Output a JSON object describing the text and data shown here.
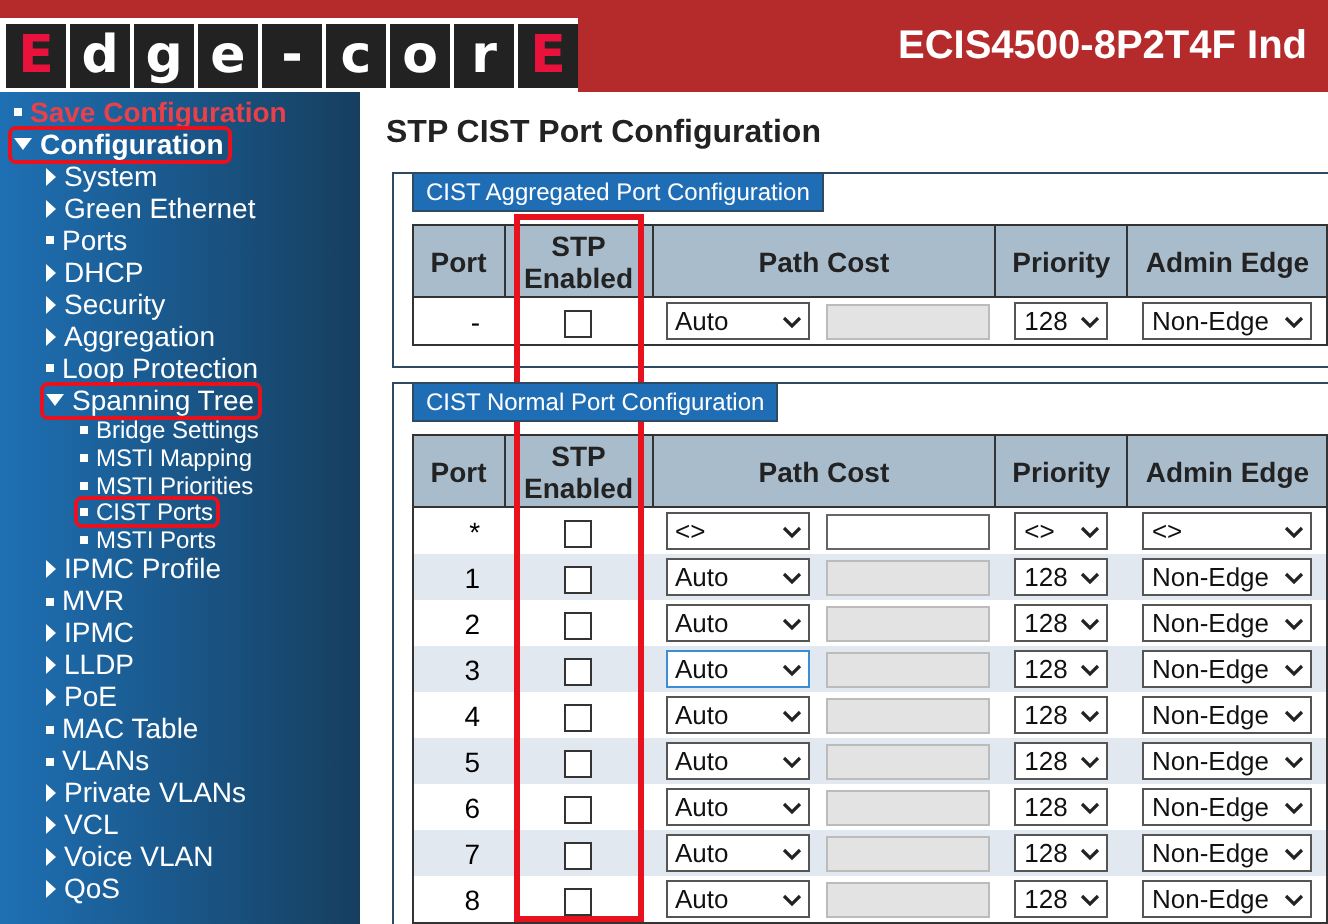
{
  "header": {
    "logo": [
      {
        "char": "E",
        "accent": true
      },
      {
        "char": "d",
        "accent": false
      },
      {
        "char": "g",
        "accent": false
      },
      {
        "char": "e",
        "accent": false
      },
      {
        "char": "-",
        "accent": false
      },
      {
        "char": "c",
        "accent": false
      },
      {
        "char": "o",
        "accent": false
      },
      {
        "char": "r",
        "accent": false
      },
      {
        "char": "E",
        "accent": true
      }
    ],
    "title": "ECIS4500-8P2T4F Ind"
  },
  "sidebar": {
    "items": [
      {
        "label": "Save Configuration",
        "kind": "action",
        "highlighted": false
      },
      {
        "label": "Configuration",
        "kind": "expanded",
        "highlighted": true,
        "children": [
          {
            "label": "System",
            "kind": "collapsed",
            "highlighted": false
          },
          {
            "label": "Green Ethernet",
            "kind": "collapsed",
            "highlighted": false
          },
          {
            "label": "Ports",
            "kind": "leaf",
            "highlighted": false
          },
          {
            "label": "DHCP",
            "kind": "collapsed",
            "highlighted": false
          },
          {
            "label": "Security",
            "kind": "collapsed",
            "highlighted": false
          },
          {
            "label": "Aggregation",
            "kind": "collapsed",
            "highlighted": false
          },
          {
            "label": "Loop Protection",
            "kind": "leaf",
            "highlighted": false
          },
          {
            "label": "Spanning Tree",
            "kind": "expanded",
            "highlighted": true,
            "children": [
              {
                "label": "Bridge Settings",
                "kind": "leaf",
                "highlighted": false
              },
              {
                "label": "MSTI Mapping",
                "kind": "leaf",
                "highlighted": false
              },
              {
                "label": "MSTI Priorities",
                "kind": "leaf",
                "highlighted": false
              },
              {
                "label": "CIST Ports",
                "kind": "leaf",
                "highlighted": true
              },
              {
                "label": "MSTI Ports",
                "kind": "leaf",
                "highlighted": false
              }
            ]
          },
          {
            "label": "IPMC Profile",
            "kind": "collapsed",
            "highlighted": false
          },
          {
            "label": "MVR",
            "kind": "leaf",
            "highlighted": false
          },
          {
            "label": "IPMC",
            "kind": "collapsed",
            "highlighted": false
          },
          {
            "label": "LLDP",
            "kind": "collapsed",
            "highlighted": false
          },
          {
            "label": "PoE",
            "kind": "collapsed",
            "highlighted": false
          },
          {
            "label": "MAC Table",
            "kind": "leaf",
            "highlighted": false
          },
          {
            "label": "VLANs",
            "kind": "leaf",
            "highlighted": false
          },
          {
            "label": "Private VLANs",
            "kind": "collapsed",
            "highlighted": false
          },
          {
            "label": "VCL",
            "kind": "collapsed",
            "highlighted": false
          },
          {
            "label": "Voice VLAN",
            "kind": "collapsed",
            "highlighted": false
          },
          {
            "label": "QoS",
            "kind": "collapsed",
            "highlighted": false
          }
        ]
      }
    ]
  },
  "page_title": "STP CIST Port Configuration",
  "sections": [
    {
      "title": "CIST Aggregated Port Configuration",
      "columns": [
        {
          "label": "Port",
          "highlighted": false
        },
        {
          "label": "STP Enabled",
          "highlighted": true
        },
        {
          "label": "Path Cost",
          "highlighted": false
        },
        {
          "label": "Priority",
          "highlighted": false
        },
        {
          "label": "Admin Edge",
          "highlighted": false
        }
      ],
      "rows": [
        {
          "port": "-",
          "stp_enabled": false,
          "path_cost_mode": "Auto",
          "path_cost_focused": false,
          "path_cost_disabled": true,
          "priority": "128",
          "admin_edge": "Non-Edge"
        }
      ]
    },
    {
      "title": "CIST Normal Port Configuration",
      "columns": [
        {
          "label": "Port"
        },
        {
          "label": "STP Enabled"
        },
        {
          "label": "Path Cost"
        },
        {
          "label": "Priority"
        },
        {
          "label": "Admin Edge"
        }
      ],
      "rows": [
        {
          "port": "*",
          "stp_enabled": false,
          "path_cost_mode": "<>",
          "path_cost_focused": false,
          "path_cost_disabled": false,
          "priority": "<>",
          "admin_edge": "<>"
        },
        {
          "port": "1",
          "stp_enabled": false,
          "path_cost_mode": "Auto",
          "path_cost_focused": false,
          "path_cost_disabled": true,
          "priority": "128",
          "admin_edge": "Non-Edge"
        },
        {
          "port": "2",
          "stp_enabled": false,
          "path_cost_mode": "Auto",
          "path_cost_focused": false,
          "path_cost_disabled": true,
          "priority": "128",
          "admin_edge": "Non-Edge"
        },
        {
          "port": "3",
          "stp_enabled": false,
          "path_cost_mode": "Auto",
          "path_cost_focused": true,
          "path_cost_disabled": true,
          "priority": "128",
          "admin_edge": "Non-Edge"
        },
        {
          "port": "4",
          "stp_enabled": false,
          "path_cost_mode": "Auto",
          "path_cost_focused": false,
          "path_cost_disabled": true,
          "priority": "128",
          "admin_edge": "Non-Edge"
        },
        {
          "port": "5",
          "stp_enabled": false,
          "path_cost_mode": "Auto",
          "path_cost_focused": false,
          "path_cost_disabled": true,
          "priority": "128",
          "admin_edge": "Non-Edge"
        },
        {
          "port": "6",
          "stp_enabled": false,
          "path_cost_mode": "Auto",
          "path_cost_focused": false,
          "path_cost_disabled": true,
          "priority": "128",
          "admin_edge": "Non-Edge"
        },
        {
          "port": "7",
          "stp_enabled": false,
          "path_cost_mode": "Auto",
          "path_cost_focused": false,
          "path_cost_disabled": true,
          "priority": "128",
          "admin_edge": "Non-Edge"
        },
        {
          "port": "8",
          "stp_enabled": false,
          "path_cost_mode": "Auto",
          "path_cost_focused": false,
          "path_cost_disabled": true,
          "priority": "128",
          "admin_edge": "Non-Edge"
        }
      ]
    }
  ]
}
